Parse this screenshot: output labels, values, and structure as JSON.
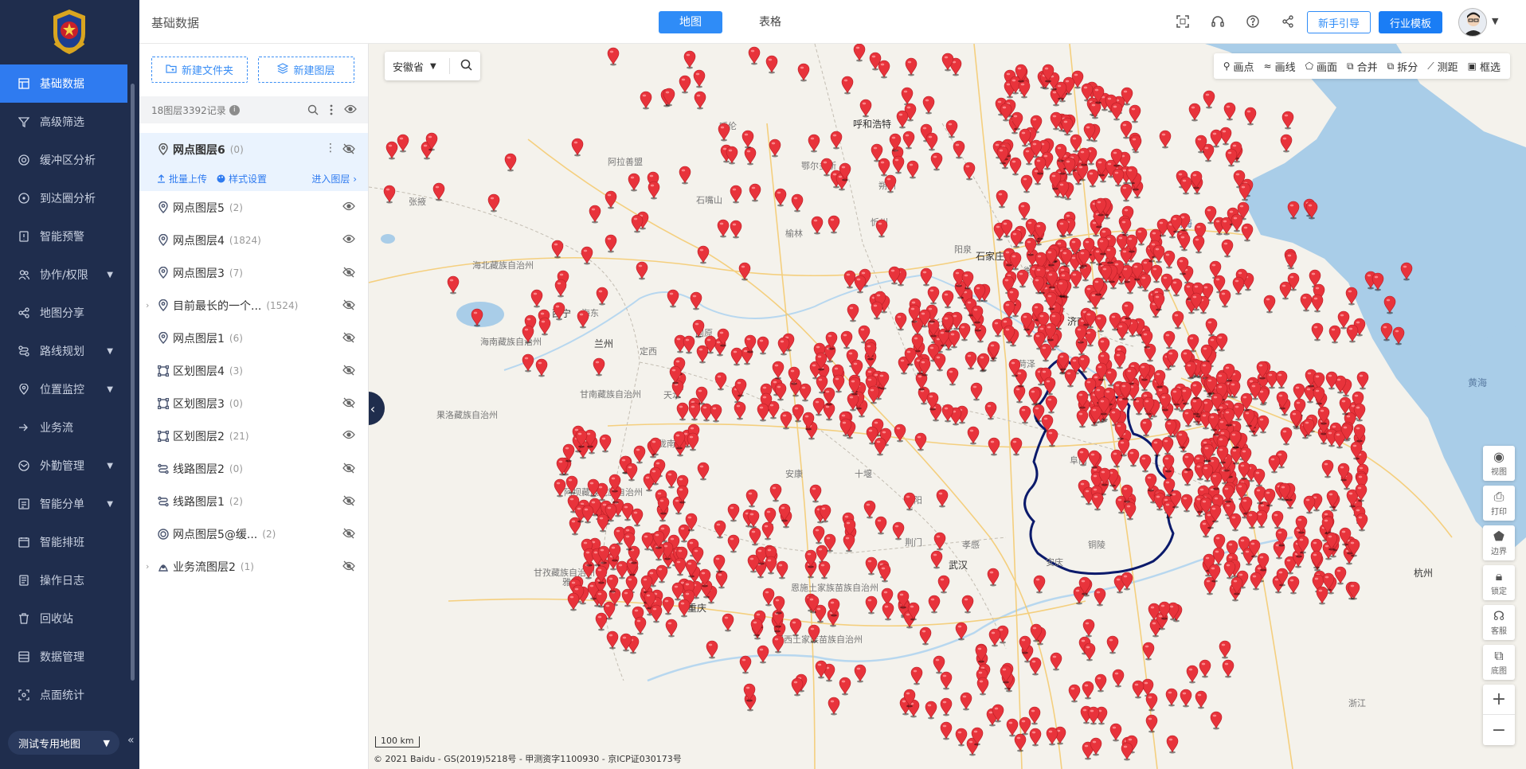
{
  "nav": {
    "items": [
      {
        "label": "基础数据",
        "icon": "grid-icon",
        "active": true,
        "expandable": false
      },
      {
        "label": "高级筛选",
        "icon": "filter-icon",
        "expandable": false
      },
      {
        "label": "缓冲区分析",
        "icon": "buffer-icon",
        "expandable": false
      },
      {
        "label": "到达圈分析",
        "icon": "reach-icon",
        "expandable": false
      },
      {
        "label": "智能预警",
        "icon": "alert-icon",
        "expandable": false
      },
      {
        "label": "协作/权限",
        "icon": "users-icon",
        "expandable": true
      },
      {
        "label": "地图分享",
        "icon": "share-icon",
        "expandable": false
      },
      {
        "label": "路线规划",
        "icon": "route-icon",
        "expandable": true
      },
      {
        "label": "位置监控",
        "icon": "location-icon",
        "expandable": true
      },
      {
        "label": "业务流",
        "icon": "flow-icon",
        "expandable": false
      },
      {
        "label": "外勤管理",
        "icon": "field-icon",
        "expandable": true
      },
      {
        "label": "智能分单",
        "icon": "dispatch-icon",
        "expandable": true
      },
      {
        "label": "智能排班",
        "icon": "schedule-icon",
        "expandable": false
      },
      {
        "label": "操作日志",
        "icon": "log-icon",
        "expandable": false
      },
      {
        "label": "回收站",
        "icon": "trash-icon",
        "expandable": false
      },
      {
        "label": "数据管理",
        "icon": "data-icon",
        "expandable": false
      },
      {
        "label": "点面统计",
        "icon": "stats-icon",
        "expandable": false
      }
    ],
    "map_selector": "测试专用地图"
  },
  "header": {
    "title": "基础数据",
    "tabs": [
      {
        "label": "地图",
        "active": true
      },
      {
        "label": "表格",
        "active": false
      }
    ],
    "guide_btn": "新手引导",
    "template_btn": "行业模板"
  },
  "panel": {
    "new_folder": "新建文件夹",
    "new_layer": "新建图层",
    "summary": "18图层3392记录",
    "selected_layer": {
      "name": "网点图层6",
      "count": "(0)"
    },
    "actions": {
      "upload": "批量上传",
      "style": "样式设置",
      "enter": "进入图层"
    },
    "layers": [
      {
        "name": "网点图层5",
        "count": "(2)",
        "icon": "pin-icon",
        "visible": true
      },
      {
        "name": "网点图层4",
        "count": "(1824)",
        "icon": "pin-icon",
        "visible": true
      },
      {
        "name": "网点图层3",
        "count": "(7)",
        "icon": "pin-icon",
        "visible": false
      },
      {
        "name": "目前最长的一个...",
        "count": "(1524)",
        "icon": "pin-icon",
        "visible": false,
        "expandable": true
      },
      {
        "name": "网点图层1",
        "count": "(6)",
        "icon": "pin-icon",
        "visible": false
      },
      {
        "name": "区划图层4",
        "count": "(3)",
        "icon": "polygon-icon",
        "visible": false
      },
      {
        "name": "区划图层3",
        "count": "(0)",
        "icon": "polygon-icon",
        "visible": false
      },
      {
        "name": "区划图层2",
        "count": "(21)",
        "icon": "polygon-icon",
        "visible": true
      },
      {
        "name": "线路图层2",
        "count": "(0)",
        "icon": "route-icon",
        "visible": false
      },
      {
        "name": "线路图层1",
        "count": "(2)",
        "icon": "route-icon",
        "visible": false
      },
      {
        "name": "网点图层5@缓...",
        "count": "(2)",
        "icon": "buffer-icon",
        "visible": false
      },
      {
        "name": "业务流图层2",
        "count": "(1)",
        "icon": "flow-icon",
        "visible": false,
        "expandable": true
      }
    ]
  },
  "map": {
    "region": "安徽省",
    "tools": [
      "画点",
      "画线",
      "画面",
      "合并",
      "拆分",
      "测距",
      "框选"
    ],
    "side_tools": [
      "视图",
      "打印",
      "边界",
      "锁定",
      "客服",
      "底图"
    ],
    "scale": "100 km",
    "copyright": "© 2021 Baidu - GS(2019)5218号 - 甲测资字1100930 - 京ICP证030173号",
    "labels": [
      "呼和浩特",
      "天津",
      "渤海",
      "西宁",
      "海东",
      "兰州",
      "济南",
      "黄海",
      "武汉",
      "杭州",
      "海北藏族自治州",
      "海南藏族自治州",
      "甘南藏族自治州",
      "果洛藏族自治州",
      "阿坝藏族羌族自治州",
      "甘孜藏族自治州",
      "阿拉善盟",
      "石嘴山",
      "固原",
      "定西",
      "天水",
      "陇南",
      "安康",
      "十堰",
      "襄阳",
      "荆门",
      "孝感",
      "安庆",
      "铜陵",
      "重庆",
      "长治",
      "石家庄",
      "阳泉",
      "衡水",
      "菏泽",
      "雅安",
      "恩施土家族苗族自治州",
      "湘西土家族苗族自治州",
      "张掖",
      "榆林",
      "阜阳",
      "浙江",
      "呼伦",
      "鄂尔多斯",
      "朔州",
      "忻州"
    ],
    "accent": "#2f8cf7",
    "marker_color": "#e8333b",
    "boundary_color": "#0b1a6b"
  }
}
